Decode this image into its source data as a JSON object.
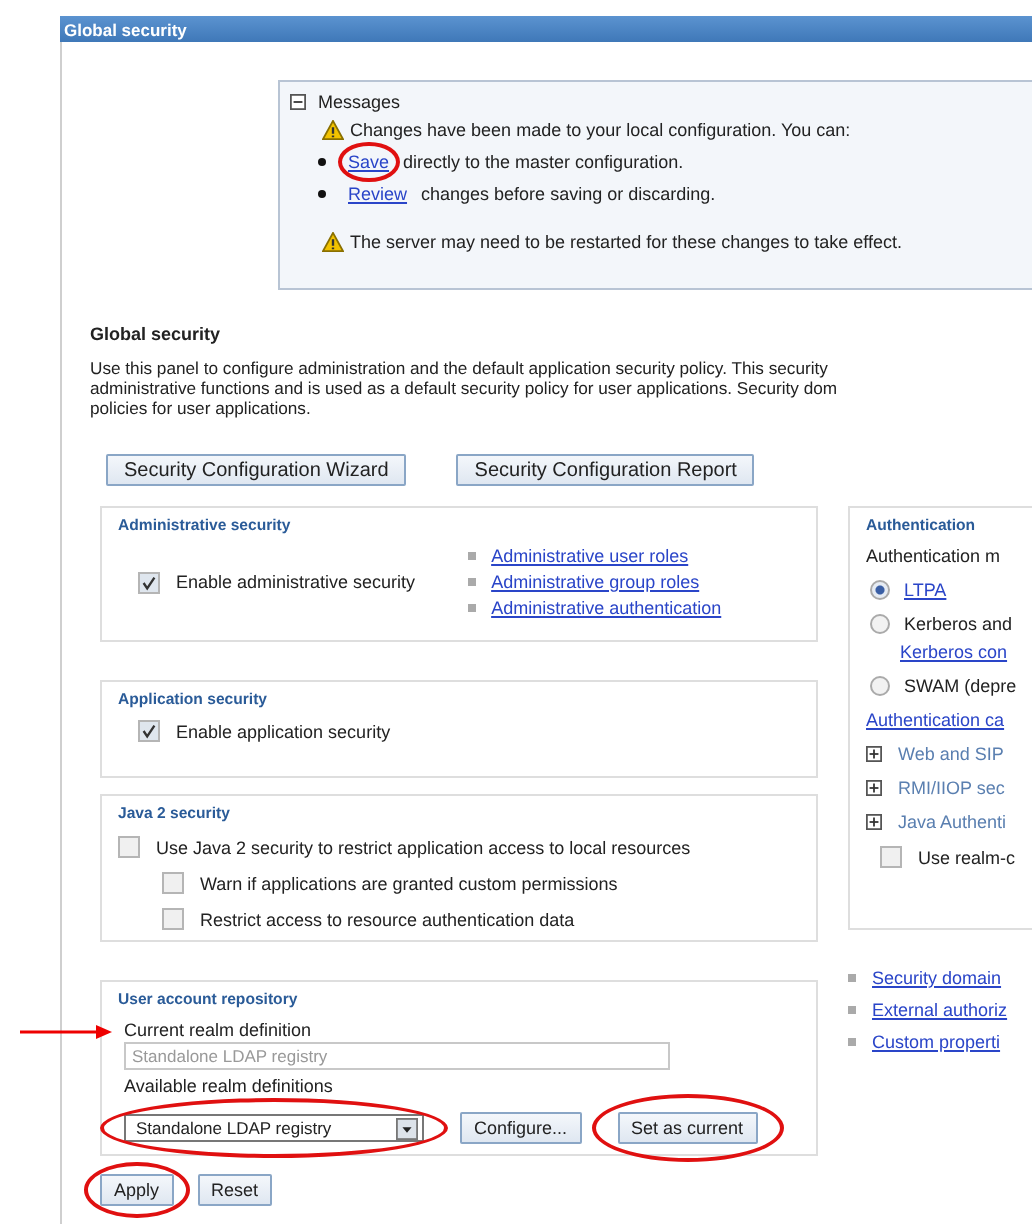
{
  "header": {
    "title": "Global security"
  },
  "messages": {
    "title": "Messages",
    "expanded": true,
    "warning": "Changes have been made to your local configuration. You can:",
    "items": [
      {
        "link": "Save",
        "text": "directly to the master configuration."
      },
      {
        "link": "Review",
        "text": "changes before saving or discarding."
      }
    ],
    "note": "The server may need to be restarted for these changes to take effect."
  },
  "section_title": "Global security",
  "description_lines": [
    "Use this panel to configure administration and the default application security policy. This security",
    "administrative functions and is used as a default security policy for user applications. Security dom",
    "policies for user applications."
  ],
  "buttons": [
    "Security Configuration Wizard",
    "Security Configuration Report"
  ],
  "administrative_security": {
    "legend": "Administrative security",
    "checkbox": {
      "label": "Enable administrative security",
      "checked": true
    },
    "links": [
      "Administrative user roles",
      "Administrative group roles",
      "Administrative authentication"
    ]
  },
  "application_security": {
    "legend": "Application security",
    "checkbox": {
      "label": "Enable application security",
      "checked": true
    }
  },
  "java2_security": {
    "legend": "Java 2 security",
    "options": [
      {
        "label": "Use Java 2 security to restrict application access to local resources",
        "checked": false,
        "children": [
          {
            "label": "Warn if applications are granted custom permissions",
            "checked": false
          },
          {
            "label": "Restrict access to resource authentication data",
            "checked": false
          }
        ]
      }
    ]
  },
  "user_account_repository": {
    "legend": "User account repository",
    "current_label": "Current realm definition",
    "current_value": "Standalone LDAP registry",
    "available_label": "Available realm definitions",
    "available_value": "Standalone LDAP registry",
    "buttons": [
      "Configure...",
      "Set as current"
    ]
  },
  "authentication": {
    "legend": "Authentication",
    "label": "Authentication m",
    "items": [
      {
        "kind": "radio",
        "label": "LTPA",
        "link": true,
        "selected": true
      },
      {
        "kind": "radio",
        "label": "Kerberos and",
        "link": false,
        "selected": false,
        "sublink": "Kerberos con"
      },
      {
        "kind": "radio",
        "label": "SWAM (depre",
        "link": false,
        "selected": false
      },
      {
        "kind": "link",
        "label": "Authentication ca"
      },
      {
        "kind": "section",
        "label": "Web and SIP",
        "expanded": false
      },
      {
        "kind": "section",
        "label": "RMI/IIOP sec",
        "expanded": false
      },
      {
        "kind": "section",
        "label": "Java Authenti",
        "expanded": false
      },
      {
        "kind": "checkbox",
        "label": "Use realm-c",
        "checked": false
      }
    ]
  },
  "related_links": [
    "Security domain",
    "External authoriz",
    "Custom properti"
  ],
  "form_buttons": [
    "Apply",
    "Reset"
  ]
}
